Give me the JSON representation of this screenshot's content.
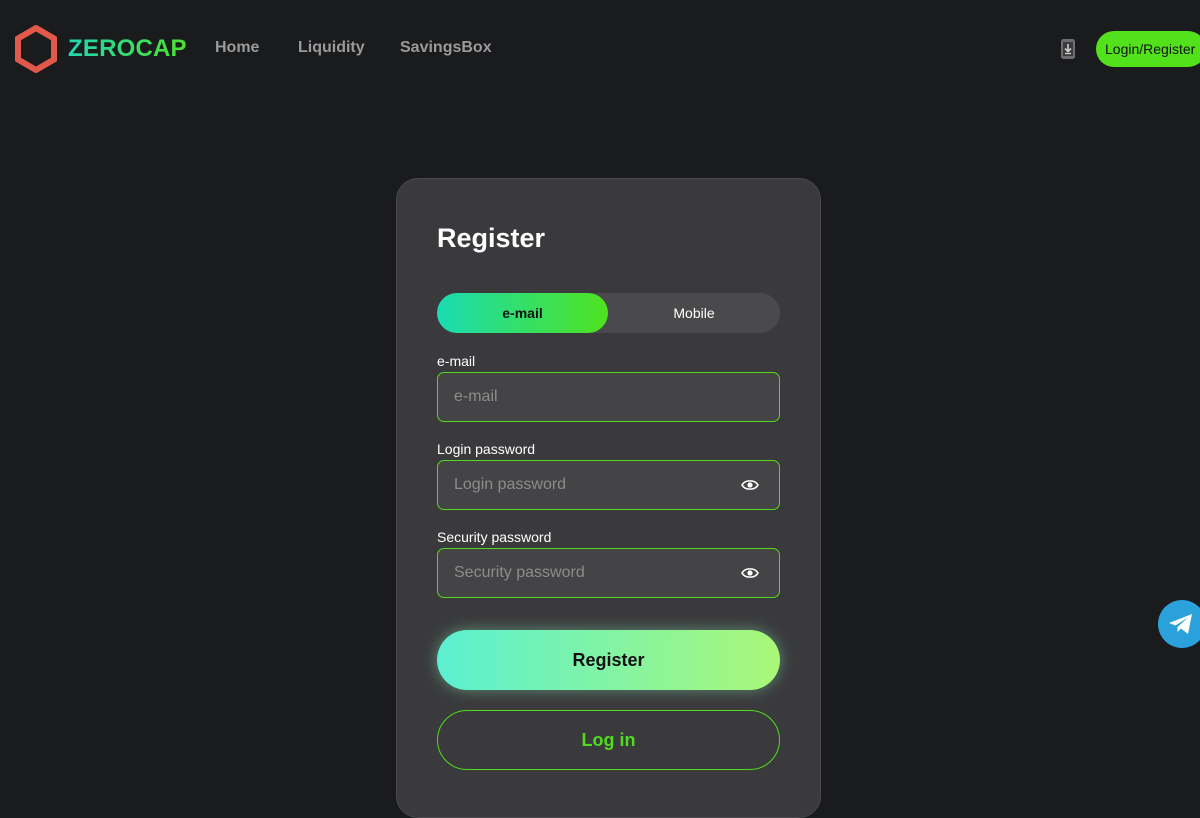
{
  "header": {
    "brand": "ZEROCAP",
    "logo_icon": "hexagon-logo-icon",
    "nav": [
      {
        "label": "Home"
      },
      {
        "label": "Liquidity"
      },
      {
        "label": "SavingsBox"
      }
    ],
    "download_icon": "download-app-icon",
    "login_register_label": "Login/Register"
  },
  "register_form": {
    "title": "Register",
    "tabs": [
      {
        "label": "e-mail",
        "active": true
      },
      {
        "label": "Mobile",
        "active": false
      }
    ],
    "fields": [
      {
        "label": "e-mail",
        "placeholder": "e-mail",
        "value": ""
      },
      {
        "label": "Login password",
        "placeholder": "Login password",
        "value": ""
      },
      {
        "label": "Security password",
        "placeholder": "Security password",
        "value": ""
      }
    ],
    "register_label": "Register",
    "login_label": "Log in"
  },
  "floating": {
    "telegram_icon": "telegram-icon"
  },
  "colors": {
    "background": "#1a1b1d",
    "card": "#3a3a3c",
    "accent_green": "#52e21c",
    "accent_teal": "#1adcb4",
    "logo_red": "#e2584a",
    "telegram_blue": "#2aa1da"
  }
}
